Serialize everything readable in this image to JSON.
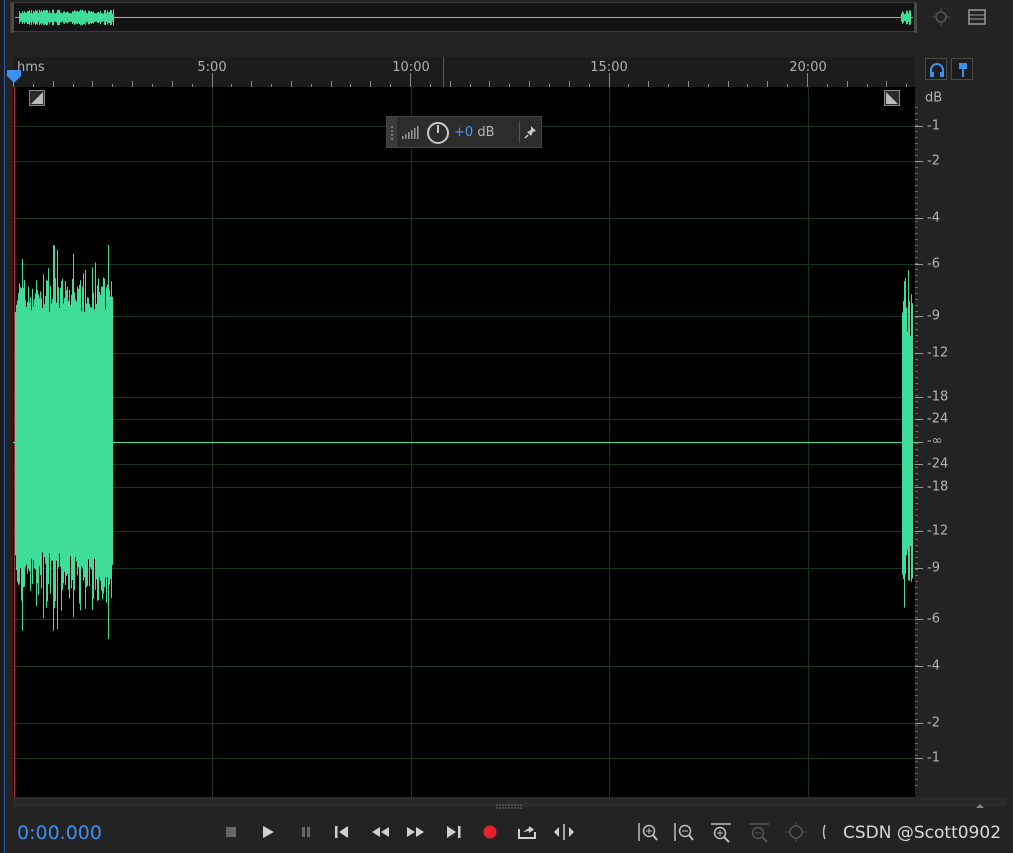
{
  "ruler": {
    "unit_label": "hms",
    "ticks": [
      "5:00",
      "10:00",
      "15:00",
      "20:00"
    ]
  },
  "db_scale": {
    "unit": "dB",
    "labels_top": [
      "-1",
      "-2",
      "-4",
      "-6",
      "-9",
      "-12",
      "-18",
      "-24"
    ],
    "center": "-∞",
    "labels_bottom": [
      "-24",
      "-18",
      "-12",
      "-9",
      "-6",
      "-4",
      "-2",
      "-1"
    ]
  },
  "hud": {
    "volume_value": "+0",
    "volume_unit": "dB"
  },
  "transport": {
    "time": "0:00.000"
  },
  "watermark": "CSDN @Scott0902",
  "colors": {
    "waveform": "#3fdc9a",
    "accent_blue": "#3d8ff0",
    "record_red": "#e8232e",
    "playhead_red": "#c8262a"
  },
  "icons": {
    "zoom_to_selection": "zoom-to-selection-icon",
    "overview_menu": "overview-menu-icon",
    "headphones": "headphones-icon",
    "timeline_marker": "pin-marker-icon"
  }
}
